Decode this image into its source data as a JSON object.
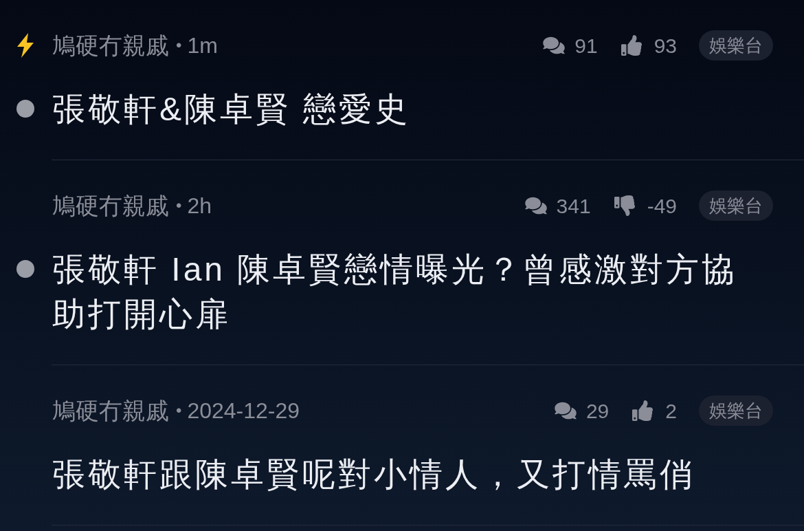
{
  "posts": [
    {
      "hot": true,
      "unread": true,
      "author": "鳩硬冇親戚",
      "separator": "•",
      "time": "1m",
      "comments": "91",
      "vote": {
        "kind": "up",
        "count": "93"
      },
      "tag": "娛樂台",
      "title": "張敬軒&陳卓賢 戀愛史"
    },
    {
      "hot": false,
      "unread": true,
      "author": "鳩硬冇親戚",
      "separator": "•",
      "time": "2h",
      "comments": "341",
      "vote": {
        "kind": "down",
        "count": "-49"
      },
      "tag": "娛樂台",
      "title": "張敬軒 Ian 陳卓賢戀情曝光？曾感激對方協助打開心扉"
    },
    {
      "hot": false,
      "unread": false,
      "author": "鳩硬冇親戚",
      "separator": "•",
      "time": "2024-12-29",
      "comments": "29",
      "vote": {
        "kind": "up",
        "count": "2"
      },
      "tag": "娛樂台",
      "title": "張敬軒跟陳卓賢呢對小情人，又打情罵俏"
    }
  ]
}
